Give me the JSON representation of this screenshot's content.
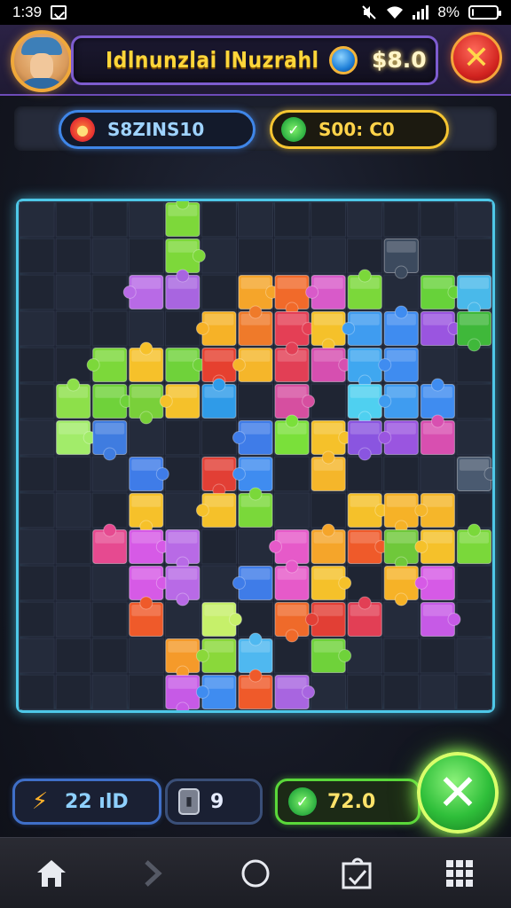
{
  "status_bar": {
    "time": "1:39",
    "battery_text": "8%",
    "battery_level": 0.08,
    "icons": [
      "image-icon",
      "mute-icon",
      "wifi-icon",
      "signal-icon",
      "battery-icon"
    ]
  },
  "header": {
    "title": "Idlnunzlai lNuzrahl",
    "coins": "$8.0",
    "coin_icon": "coin-icon",
    "close_icon": "close-x-icon"
  },
  "score_strip": {
    "moves_label": "S8ZINS10",
    "time_label": "S00: C0",
    "moves_icon": "moves-icon",
    "time_icon": "check-icon"
  },
  "board": {
    "rows": 14,
    "cols": 13,
    "pieces": [
      {
        "r": 0,
        "c": 4,
        "color": "#7dd83a"
      },
      {
        "r": 1,
        "c": 4,
        "color": "#7dd83a"
      },
      {
        "r": 1,
        "c": 10,
        "color": "#3c4a5e"
      },
      {
        "r": 2,
        "c": 3,
        "color": "#b86ae6"
      },
      {
        "r": 2,
        "c": 4,
        "color": "#a865e0"
      },
      {
        "r": 2,
        "c": 6,
        "color": "#f5a52a"
      },
      {
        "r": 2,
        "c": 7,
        "color": "#f16a2a"
      },
      {
        "r": 2,
        "c": 8,
        "color": "#d85ac9"
      },
      {
        "r": 2,
        "c": 9,
        "color": "#7bd83a"
      },
      {
        "r": 2,
        "c": 11,
        "color": "#67d23a"
      },
      {
        "r": 2,
        "c": 12,
        "color": "#49b9ea"
      },
      {
        "r": 3,
        "c": 5,
        "color": "#f6b227"
      },
      {
        "r": 3,
        "c": 6,
        "color": "#ef7a2a"
      },
      {
        "r": 3,
        "c": 7,
        "color": "#e43f55"
      },
      {
        "r": 3,
        "c": 8,
        "color": "#f5c12a"
      },
      {
        "r": 3,
        "c": 9,
        "color": "#3f9cf0"
      },
      {
        "r": 3,
        "c": 10,
        "color": "#3f8cf0"
      },
      {
        "r": 3,
        "c": 11,
        "color": "#9a55e0"
      },
      {
        "r": 3,
        "c": 12,
        "color": "#3fb83a"
      },
      {
        "r": 4,
        "c": 2,
        "color": "#7cd83a"
      },
      {
        "r": 4,
        "c": 3,
        "color": "#f6c12a"
      },
      {
        "r": 4,
        "c": 4,
        "color": "#6fd23a"
      },
      {
        "r": 4,
        "c": 5,
        "color": "#e6402f"
      },
      {
        "r": 4,
        "c": 6,
        "color": "#f5b62a"
      },
      {
        "r": 4,
        "c": 7,
        "color": "#e23f55"
      },
      {
        "r": 4,
        "c": 8,
        "color": "#d64fb0"
      },
      {
        "r": 4,
        "c": 9,
        "color": "#3fa7f0"
      },
      {
        "r": 4,
        "c": 10,
        "color": "#3f8cf0"
      },
      {
        "r": 5,
        "c": 1,
        "color": "#8de04a"
      },
      {
        "r": 5,
        "c": 2,
        "color": "#6fd23a"
      },
      {
        "r": 5,
        "c": 3,
        "color": "#79d03a"
      },
      {
        "r": 5,
        "c": 4,
        "color": "#f5c12a"
      },
      {
        "r": 5,
        "c": 5,
        "color": "#2f9be8"
      },
      {
        "r": 5,
        "c": 7,
        "color": "#d64fa0"
      },
      {
        "r": 5,
        "c": 9,
        "color": "#4fd0f0"
      },
      {
        "r": 5,
        "c": 10,
        "color": "#3f9cf0"
      },
      {
        "r": 5,
        "c": 11,
        "color": "#3f8cf0"
      },
      {
        "r": 6,
        "c": 1,
        "color": "#a2ec6a"
      },
      {
        "r": 6,
        "c": 2,
        "color": "#3f7ce0"
      },
      {
        "r": 6,
        "c": 6,
        "color": "#3f7ce8"
      },
      {
        "r": 6,
        "c": 7,
        "color": "#7ae03a"
      },
      {
        "r": 6,
        "c": 8,
        "color": "#f5c12a"
      },
      {
        "r": 6,
        "c": 9,
        "color": "#8a55e0"
      },
      {
        "r": 6,
        "c": 10,
        "color": "#9a55e0"
      },
      {
        "r": 6,
        "c": 11,
        "color": "#d84fb0"
      },
      {
        "r": 7,
        "c": 3,
        "color": "#3f7ce8"
      },
      {
        "r": 7,
        "c": 5,
        "color": "#e23f35"
      },
      {
        "r": 7,
        "c": 6,
        "color": "#3f8cf0"
      },
      {
        "r": 7,
        "c": 8,
        "color": "#f5b62a"
      },
      {
        "r": 7,
        "c": 12,
        "color": "#4a5a70"
      },
      {
        "r": 8,
        "c": 3,
        "color": "#f6c12a"
      },
      {
        "r": 8,
        "c": 5,
        "color": "#f5c12a"
      },
      {
        "r": 8,
        "c": 6,
        "color": "#7ad83a"
      },
      {
        "r": 8,
        "c": 9,
        "color": "#f5c12a"
      },
      {
        "r": 8,
        "c": 10,
        "color": "#f6b227"
      },
      {
        "r": 8,
        "c": 11,
        "color": "#f5b62a"
      },
      {
        "r": 9,
        "c": 2,
        "color": "#e64a90"
      },
      {
        "r": 9,
        "c": 3,
        "color": "#d65ae6"
      },
      {
        "r": 9,
        "c": 4,
        "color": "#b86ae6"
      },
      {
        "r": 9,
        "c": 7,
        "color": "#e65ac9"
      },
      {
        "r": 9,
        "c": 8,
        "color": "#f5a52a"
      },
      {
        "r": 9,
        "c": 9,
        "color": "#ef5a2a"
      },
      {
        "r": 9,
        "c": 10,
        "color": "#6fc83a"
      },
      {
        "r": 9,
        "c": 11,
        "color": "#f5c12a"
      },
      {
        "r": 9,
        "c": 12,
        "color": "#7ad83a"
      },
      {
        "r": 10,
        "c": 3,
        "color": "#d65ae6"
      },
      {
        "r": 10,
        "c": 4,
        "color": "#b86ae6"
      },
      {
        "r": 10,
        "c": 6,
        "color": "#3f7ce8"
      },
      {
        "r": 10,
        "c": 7,
        "color": "#e65ac9"
      },
      {
        "r": 10,
        "c": 8,
        "color": "#f5c12a"
      },
      {
        "r": 10,
        "c": 10,
        "color": "#f6b227"
      },
      {
        "r": 10,
        "c": 11,
        "color": "#d65ae6"
      },
      {
        "r": 11,
        "c": 3,
        "color": "#ef5a2a"
      },
      {
        "r": 11,
        "c": 5,
        "color": "#c6f06a"
      },
      {
        "r": 11,
        "c": 7,
        "color": "#ef6a2a"
      },
      {
        "r": 11,
        "c": 8,
        "color": "#e23f35"
      },
      {
        "r": 11,
        "c": 9,
        "color": "#e23f55"
      },
      {
        "r": 11,
        "c": 11,
        "color": "#c65ae6"
      },
      {
        "r": 12,
        "c": 4,
        "color": "#f59a2a"
      },
      {
        "r": 12,
        "c": 5,
        "color": "#8ad83a"
      },
      {
        "r": 12,
        "c": 6,
        "color": "#4fb8f0"
      },
      {
        "r": 12,
        "c": 8,
        "color": "#6fd23a"
      },
      {
        "r": 13,
        "c": 4,
        "color": "#c65ae6"
      },
      {
        "r": 13,
        "c": 5,
        "color": "#3f8cf0"
      },
      {
        "r": 13,
        "c": 6,
        "color": "#ef5a2a"
      },
      {
        "r": 13,
        "c": 7,
        "color": "#a865e0"
      }
    ]
  },
  "bottom_bar": {
    "energy_value": "22 ılD",
    "pieces_value": "9",
    "score_value": "72.0",
    "energy_icon": "lightning-icon",
    "pieces_icon": "battery-icon",
    "score_icon": "check-icon",
    "confirm_icon": "x-icon"
  },
  "nav": {
    "items": [
      "home-icon",
      "forward-icon",
      "circle-icon",
      "puzzle-icon",
      "grid-icon"
    ]
  }
}
